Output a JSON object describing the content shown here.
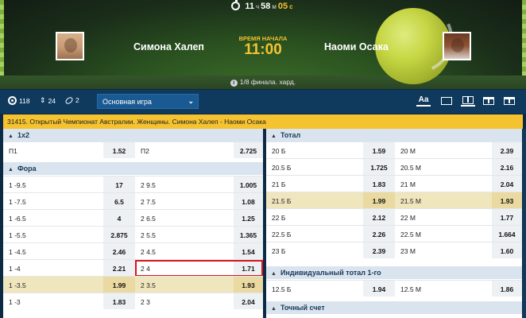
{
  "timer": {
    "h": "11",
    "h_unit": "ч",
    "m": "58",
    "m_unit": "м",
    "s": "05",
    "s_unit": "с"
  },
  "match": {
    "player1": "Симона Халеп",
    "player2": "Наоми Осака",
    "start_label": "ВРЕМЯ НАЧАЛА",
    "start_time": "11:00",
    "round": "1/8 финала. хард."
  },
  "toolbar": {
    "count_markets": "118",
    "count_updown": "24",
    "count_stats": "2",
    "select_value": "Основная игра"
  },
  "event_title": "31415. Открытый Чемпионат Австралии. Женщины. Симона Халеп - Наоми Осака",
  "left": {
    "sec1x2": "1x2",
    "p1_label": "П1",
    "p1_odd": "1.52",
    "p2_label": "П2",
    "p2_odd": "2.725",
    "fora_title": "Фора",
    "fora": [
      {
        "l1": "1 -9.5",
        "o1": "17",
        "l2": "2 9.5",
        "o2": "1.005"
      },
      {
        "l1": "1 -7.5",
        "o1": "6.5",
        "l2": "2 7.5",
        "o2": "1.08"
      },
      {
        "l1": "1 -6.5",
        "o1": "4",
        "l2": "2 6.5",
        "o2": "1.25"
      },
      {
        "l1": "1 -5.5",
        "o1": "2.875",
        "l2": "2 5.5",
        "o2": "1.365"
      },
      {
        "l1": "1 -4.5",
        "o1": "2.46",
        "l2": "2 4.5",
        "o2": "1.54"
      },
      {
        "l1": "1 -4",
        "o1": "2.21",
        "l2": "2 4",
        "o2": "1.71"
      },
      {
        "l1": "1 -3.5",
        "o1": "1.99",
        "l2": "2 3.5",
        "o2": "1.93"
      },
      {
        "l1": "1 -3",
        "o1": "1.83",
        "l2": "2 3",
        "o2": "2.04"
      }
    ]
  },
  "right": {
    "total_title": "Тотал",
    "total": [
      {
        "l1": "20 Б",
        "o1": "1.59",
        "l2": "20 М",
        "o2": "2.39"
      },
      {
        "l1": "20.5 Б",
        "o1": "1.725",
        "l2": "20.5 М",
        "o2": "2.16"
      },
      {
        "l1": "21 Б",
        "o1": "1.83",
        "l2": "21 М",
        "o2": "2.04"
      },
      {
        "l1": "21.5 Б",
        "o1": "1.99",
        "l2": "21.5 М",
        "o2": "1.93"
      },
      {
        "l1": "22 Б",
        "o1": "2.12",
        "l2": "22 М",
        "o2": "1.77"
      },
      {
        "l1": "22.5 Б",
        "o1": "2.26",
        "l2": "22.5 М",
        "o2": "1.664"
      },
      {
        "l1": "23 Б",
        "o1": "2.39",
        "l2": "23 М",
        "o2": "1.60"
      }
    ],
    "ind_title": "Индивидуальный тотал 1-го",
    "ind": {
      "l1": "12.5 Б",
      "o1": "1.94",
      "l2": "12.5 М",
      "o2": "1.86"
    },
    "score_title": "Точный счет"
  },
  "colors": {
    "accent": "#f5c230",
    "nav": "#0f3a5e",
    "highlight": "#f0e6bd",
    "selected_border": "#d8141d"
  }
}
